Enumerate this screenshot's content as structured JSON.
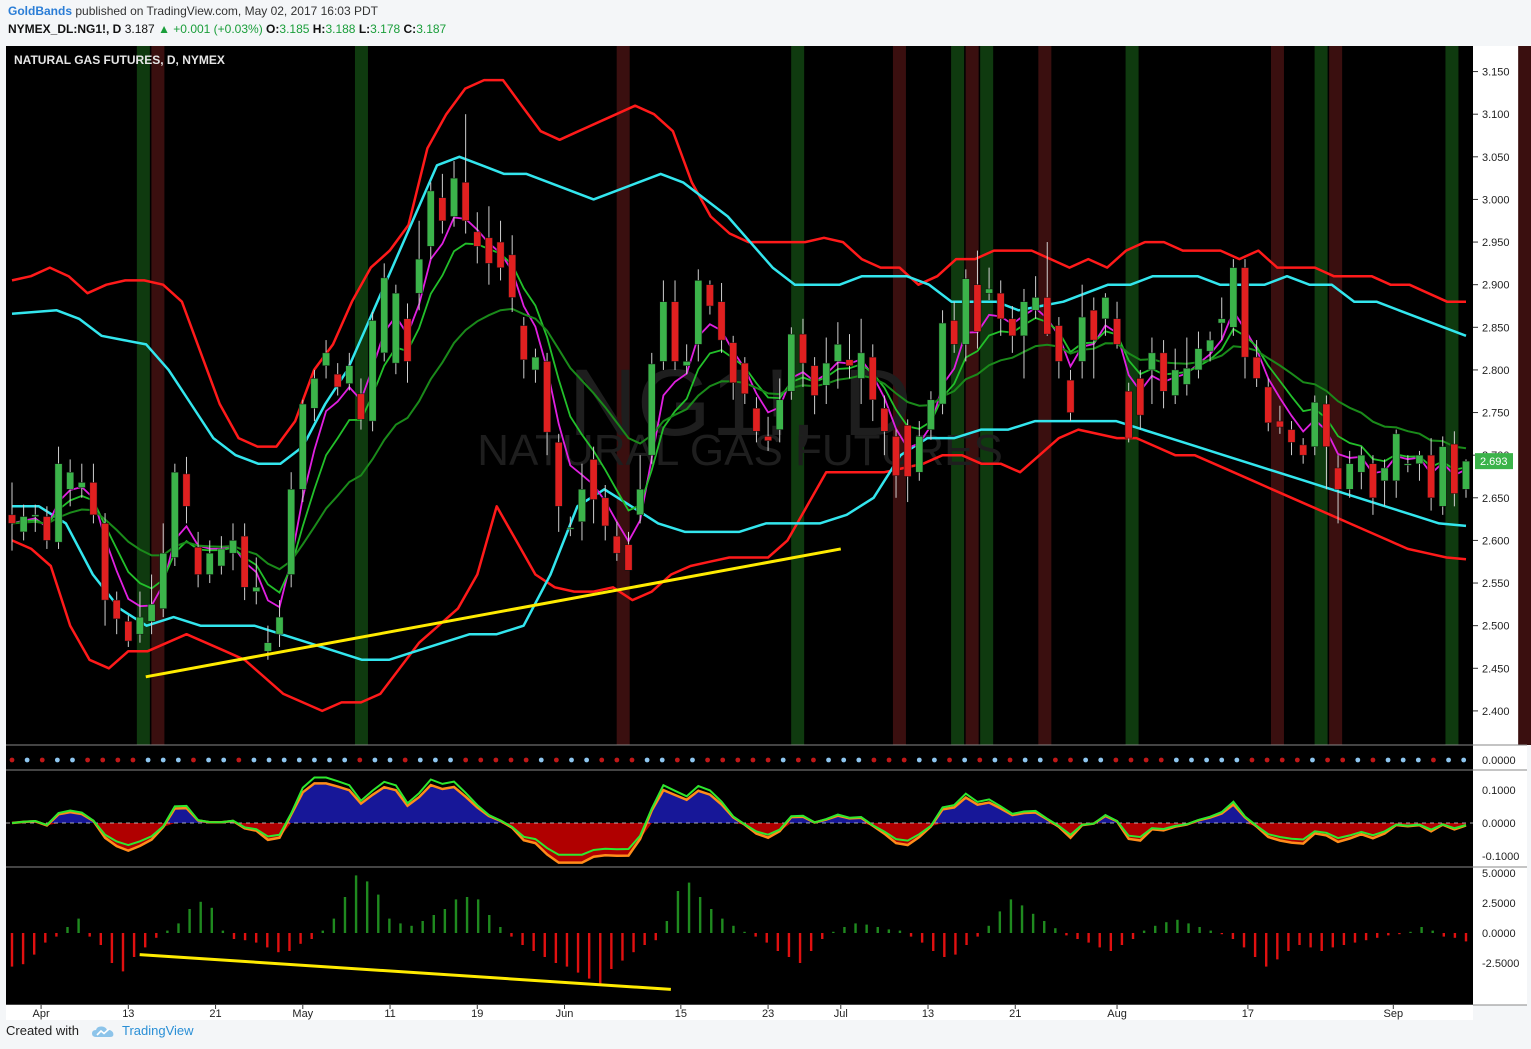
{
  "header": {
    "author": "GoldBands",
    "published": "published on TradingView.com, May 02, 2017 16:03 PDT",
    "symbol": "NYMEX_DL:NG1!, D",
    "last": "3.187",
    "change": "+0.001 (+0.03%)",
    "o_label": "O:",
    "o": "3.185",
    "h_label": "H:",
    "h": "3.188",
    "l_label": "L:",
    "l": "3.178",
    "c_label": "C:",
    "c": "3.187"
  },
  "footer": {
    "created_with": "Created with",
    "brand": "TradingView"
  },
  "colors": {
    "bull": "#3bb34a",
    "bear": "#e02020",
    "outer_band": "#ff1a1a",
    "inner_band": "#33e6ee",
    "ema_magenta": "#e020e0",
    "ema_green": "#22c02a",
    "trend": "#ffeb00"
  },
  "chart_data": {
    "type": "candlestick",
    "title": "NATURAL GAS FUTURES, D, NYMEX",
    "watermark": {
      "big": "NG1!, D",
      "sub": "NATURAL GAS FUTURES"
    },
    "last_price_label": "2.693",
    "ylim": [
      2.36,
      3.18
    ],
    "y_ticks": [
      "3.150",
      "3.100",
      "3.050",
      "3.000",
      "2.950",
      "2.900",
      "2.850",
      "2.800",
      "2.750",
      "2.700",
      "2.650",
      "2.600",
      "2.550",
      "2.500",
      "2.450",
      "2.400"
    ],
    "x_ticks": [
      {
        "label": "Apr",
        "i": 2
      },
      {
        "label": "13",
        "i": 8
      },
      {
        "label": "21",
        "i": 14
      },
      {
        "label": "May",
        "i": 20
      },
      {
        "label": "11",
        "i": 26
      },
      {
        "label": "19",
        "i": 32
      },
      {
        "label": "Jun",
        "i": 38
      },
      {
        "label": "15",
        "i": 46
      },
      {
        "label": "23",
        "i": 52
      },
      {
        "label": "Jul",
        "i": 57
      },
      {
        "label": "13",
        "i": 63
      },
      {
        "label": "21",
        "i": 69
      },
      {
        "label": "Aug",
        "i": 76
      },
      {
        "label": "17",
        "i": 85
      },
      {
        "label": "Sep",
        "i": 95
      }
    ],
    "candles": [
      [
        2.63,
        2.62,
        2.668,
        2.588
      ],
      [
        2.61,
        2.628,
        2.642,
        2.6
      ],
      [
        2.628,
        2.63,
        2.642,
        2.61
      ],
      [
        2.628,
        2.6,
        2.64,
        2.59
      ],
      [
        2.598,
        2.69,
        2.71,
        2.59
      ],
      [
        2.66,
        2.68,
        2.695,
        2.64
      ],
      [
        2.662,
        2.668,
        2.69,
        2.65
      ],
      [
        2.668,
        2.63,
        2.69,
        2.62
      ],
      [
        2.62,
        2.53,
        2.632,
        2.5
      ],
      [
        2.53,
        2.508,
        2.54,
        2.49
      ],
      [
        2.505,
        2.482,
        2.512,
        2.475
      ],
      [
        2.49,
        2.51,
        2.54,
        2.48
      ],
      [
        2.505,
        2.525,
        2.56,
        2.49
      ],
      [
        2.52,
        2.585,
        2.62,
        2.51
      ],
      [
        2.58,
        2.68,
        2.69,
        2.57
      ],
      [
        2.678,
        2.64,
        2.698,
        2.62
      ],
      [
        2.592,
        2.56,
        2.61,
        2.545
      ],
      [
        2.56,
        2.585,
        2.6,
        2.55
      ],
      [
        2.57,
        2.59,
        2.605,
        2.56
      ],
      [
        2.585,
        2.6,
        2.62,
        2.565
      ],
      [
        2.605,
        2.545,
        2.62,
        2.53
      ],
      [
        2.54,
        2.545,
        2.58,
        2.525
      ],
      [
        2.47,
        2.48,
        2.5,
        2.46
      ],
      [
        2.49,
        2.51,
        2.53,
        2.475
      ],
      [
        2.56,
        2.66,
        2.68,
        2.545
      ],
      [
        2.66,
        2.76,
        2.765,
        2.645
      ],
      [
        2.755,
        2.79,
        2.8,
        2.74
      ],
      [
        2.805,
        2.82,
        2.835,
        2.79
      ],
      [
        2.795,
        2.78,
        2.808,
        2.77
      ],
      [
        2.784,
        2.805,
        2.82,
        2.776
      ],
      [
        2.772,
        2.742,
        2.79,
        2.73
      ],
      [
        2.74,
        2.858,
        2.868,
        2.728
      ],
      [
        2.82,
        2.908,
        2.925,
        2.81
      ],
      [
        2.808,
        2.89,
        2.9,
        2.795
      ],
      [
        2.86,
        2.81,
        2.878,
        2.785
      ],
      [
        2.89,
        2.93,
        2.975,
        2.87
      ],
      [
        2.945,
        3.01,
        3.02,
        2.93
      ],
      [
        3.002,
        2.975,
        3.03,
        2.96
      ],
      [
        2.98,
        3.025,
        3.045,
        2.968
      ],
      [
        3.02,
        2.975,
        3.1,
        2.96
      ],
      [
        2.962,
        2.945,
        2.985,
        2.925
      ],
      [
        2.955,
        2.925,
        2.992,
        2.9
      ],
      [
        2.95,
        2.92,
        2.975,
        2.905
      ],
      [
        2.935,
        2.885,
        2.958,
        2.868
      ],
      [
        2.852,
        2.812,
        2.862,
        2.79
      ],
      [
        2.8,
        2.815,
        2.825,
        2.785
      ],
      [
        2.81,
        2.727,
        2.82,
        2.7
      ],
      [
        2.715,
        2.64,
        2.725,
        2.61
      ],
      [
        2.615,
        2.615,
        2.628,
        2.605
      ],
      [
        2.622,
        2.66,
        2.69,
        2.6
      ],
      [
        2.695,
        2.648,
        2.71,
        2.62
      ],
      [
        2.65,
        2.617,
        2.665,
        2.6
      ],
      [
        2.605,
        2.585,
        2.622,
        2.576
      ],
      [
        2.595,
        2.565,
        2.61,
        2.59
      ],
      [
        2.63,
        2.66,
        2.7,
        2.62
      ],
      [
        2.7,
        2.807,
        2.82,
        2.69
      ],
      [
        2.81,
        2.88,
        2.905,
        2.8
      ],
      [
        2.88,
        2.81,
        2.905,
        2.8
      ],
      [
        2.805,
        2.81,
        2.83,
        2.795
      ],
      [
        2.83,
        2.905,
        2.918,
        2.81
      ],
      [
        2.9,
        2.875,
        2.905,
        2.865
      ],
      [
        2.88,
        2.835,
        2.902,
        2.82
      ],
      [
        2.832,
        2.785,
        2.84,
        2.765
      ],
      [
        2.808,
        2.772,
        2.815,
        2.76
      ],
      [
        2.755,
        2.728,
        2.768,
        2.715
      ],
      [
        2.722,
        2.717,
        2.745,
        2.705
      ],
      [
        2.73,
        2.765,
        2.79,
        2.715
      ],
      [
        2.775,
        2.842,
        2.85,
        2.765
      ],
      [
        2.842,
        2.808,
        2.86,
        2.78
      ],
      [
        2.805,
        2.77,
        2.815,
        2.748
      ],
      [
        2.782,
        2.808,
        2.838,
        2.76
      ],
      [
        2.81,
        2.83,
        2.856,
        2.778
      ],
      [
        2.812,
        2.805,
        2.842,
        2.79
      ],
      [
        2.79,
        2.82,
        2.86,
        2.76
      ],
      [
        2.815,
        2.765,
        2.83,
        2.74
      ],
      [
        2.755,
        2.728,
        2.77,
        2.7
      ],
      [
        2.722,
        2.676,
        2.73,
        2.65
      ],
      [
        2.735,
        2.675,
        2.742,
        2.645
      ],
      [
        2.68,
        2.722,
        2.74,
        2.67
      ],
      [
        2.73,
        2.765,
        2.775,
        2.718
      ],
      [
        2.76,
        2.855,
        2.87,
        2.748
      ],
      [
        2.858,
        2.83,
        2.88,
        2.82
      ],
      [
        2.83,
        2.907,
        2.918,
        2.81
      ],
      [
        2.9,
        2.845,
        2.94,
        2.825
      ],
      [
        2.89,
        2.895,
        2.92,
        2.882
      ],
      [
        2.89,
        2.86,
        2.905,
        2.84
      ],
      [
        2.86,
        2.84,
        2.875,
        2.82
      ],
      [
        2.84,
        2.88,
        2.895,
        2.79
      ],
      [
        2.87,
        2.885,
        2.91,
        2.86
      ],
      [
        2.885,
        2.842,
        2.95,
        2.84
      ],
      [
        2.852,
        2.81,
        2.862,
        2.79
      ],
      [
        2.788,
        2.75,
        2.8,
        2.74
      ],
      [
        2.81,
        2.862,
        2.9,
        2.79
      ],
      [
        2.87,
        2.835,
        2.885,
        2.79
      ],
      [
        2.86,
        2.885,
        2.89,
        2.84
      ],
      [
        2.86,
        2.83,
        2.88,
        2.825
      ],
      [
        2.775,
        2.72,
        2.785,
        2.715
      ],
      [
        2.79,
        2.747,
        2.8,
        2.73
      ],
      [
        2.8,
        2.82,
        2.838,
        2.76
      ],
      [
        2.82,
        2.775,
        2.835,
        2.755
      ],
      [
        2.77,
        2.8,
        2.825,
        2.76
      ],
      [
        2.783,
        2.802,
        2.838,
        2.77
      ],
      [
        2.8,
        2.825,
        2.845,
        2.79
      ],
      [
        2.822,
        2.835,
        2.845,
        2.81
      ],
      [
        2.855,
        2.86,
        2.885,
        2.835
      ],
      [
        2.85,
        2.92,
        2.93,
        2.84
      ],
      [
        2.92,
        2.815,
        2.93,
        2.79
      ],
      [
        2.815,
        2.79,
        2.835,
        2.78
      ],
      [
        2.78,
        2.738,
        2.79,
        2.728
      ],
      [
        2.74,
        2.733,
        2.758,
        2.725
      ],
      [
        2.73,
        2.715,
        2.74,
        2.7
      ],
      [
        2.712,
        2.7,
        2.72,
        2.69
      ],
      [
        2.71,
        2.762,
        2.77,
        2.7
      ],
      [
        2.76,
        2.71,
        2.77,
        2.66
      ],
      [
        2.685,
        2.66,
        2.7,
        2.62
      ],
      [
        2.66,
        2.69,
        2.705,
        2.65
      ],
      [
        2.68,
        2.7,
        2.71,
        2.66
      ],
      [
        2.69,
        2.65,
        2.7,
        2.63
      ],
      [
        2.67,
        2.685,
        2.695,
        2.64
      ],
      [
        2.67,
        2.725,
        2.73,
        2.65
      ],
      [
        2.69,
        2.69,
        2.7,
        2.68
      ],
      [
        2.69,
        2.7,
        2.705,
        2.67
      ],
      [
        2.7,
        2.65,
        2.72,
        2.635
      ],
      [
        2.64,
        2.71,
        2.722,
        2.63
      ],
      [
        2.713,
        2.655,
        2.728,
        2.64
      ],
      [
        2.66,
        2.693,
        2.695,
        2.65
      ]
    ],
    "outer_upper": [
      2.905,
      2.91,
      2.92,
      2.91,
      2.89,
      2.9,
      2.905,
      2.905,
      2.9,
      2.88,
      2.82,
      2.76,
      2.72,
      2.71,
      2.71,
      2.74,
      2.8,
      2.83,
      2.88,
      2.92,
      2.94,
      2.97,
      3.06,
      3.1,
      3.13,
      3.14,
      3.14,
      3.11,
      3.08,
      3.07,
      3.08,
      3.09,
      3.1,
      3.11,
      3.1,
      3.08,
      3.02,
      2.98,
      2.96,
      2.95,
      2.95,
      2.95,
      2.95,
      2.955,
      2.95,
      2.93,
      2.92,
      2.92,
      2.9,
      2.91,
      2.93,
      2.93,
      2.94,
      2.94,
      2.94,
      2.93,
      2.92,
      2.93,
      2.92,
      2.94,
      2.95,
      2.95,
      2.94,
      2.94,
      2.94,
      2.93,
      2.94,
      2.92,
      2.92,
      2.92,
      2.91,
      2.91,
      2.91,
      2.9,
      2.9,
      2.89,
      2.88,
      2.88
    ],
    "outer_lower": [
      2.6,
      2.59,
      2.57,
      2.5,
      2.46,
      2.45,
      2.47,
      2.47,
      2.48,
      2.49,
      2.48,
      2.47,
      2.46,
      2.44,
      2.42,
      2.41,
      2.4,
      2.41,
      2.41,
      2.42,
      2.45,
      2.48,
      2.5,
      2.52,
      2.56,
      2.64,
      2.6,
      2.56,
      2.545,
      2.54,
      2.54,
      2.545,
      2.53,
      2.54,
      2.56,
      2.57,
      2.575,
      2.58,
      2.58,
      2.58,
      2.6,
      2.64,
      2.68,
      2.68,
      2.68,
      2.68,
      2.685,
      2.69,
      2.7,
      2.7,
      2.69,
      2.69,
      2.68,
      2.7,
      2.72,
      2.73,
      2.725,
      2.72,
      2.72,
      2.71,
      2.7,
      2.7,
      2.69,
      2.68,
      2.67,
      2.66,
      2.65,
      2.64,
      2.63,
      2.62,
      2.61,
      2.6,
      2.59,
      2.585,
      2.58,
      2.578
    ],
    "inner_upper": [
      2.866,
      2.868,
      2.87,
      2.86,
      2.84,
      2.835,
      2.83,
      2.8,
      2.76,
      2.72,
      2.7,
      2.69,
      2.69,
      2.71,
      2.76,
      2.8,
      2.86,
      2.92,
      2.98,
      3.04,
      3.05,
      3.04,
      3.03,
      3.03,
      3.02,
      3.01,
      3.0,
      3.01,
      3.02,
      3.03,
      3.02,
      3.0,
      2.98,
      2.95,
      2.92,
      2.9,
      2.9,
      2.9,
      2.91,
      2.91,
      2.91,
      2.9,
      2.88,
      2.88,
      2.88,
      2.87,
      2.875,
      2.88,
      2.89,
      2.9,
      2.9,
      2.91,
      2.91,
      2.91,
      2.9,
      2.9,
      2.9,
      2.91,
      2.9,
      2.9,
      2.88,
      2.88,
      2.87,
      2.86,
      2.85,
      2.84
    ],
    "inner_lower": [
      2.64,
      2.64,
      2.62,
      2.56,
      2.52,
      2.5,
      2.51,
      2.5,
      2.5,
      2.5,
      2.49,
      2.48,
      2.47,
      2.46,
      2.46,
      2.47,
      2.48,
      2.49,
      2.49,
      2.5,
      2.56,
      2.64,
      2.66,
      2.64,
      2.62,
      2.61,
      2.61,
      2.61,
      2.62,
      2.62,
      2.62,
      2.63,
      2.65,
      2.7,
      2.72,
      2.72,
      2.73,
      2.73,
      2.74,
      2.74,
      2.74,
      2.74,
      2.73,
      2.72,
      2.71,
      2.7,
      2.69,
      2.68,
      2.67,
      2.66,
      2.65,
      2.64,
      2.63,
      2.62,
      2.617
    ]
  },
  "signal_dots": {
    "zero_label": "0.0000"
  },
  "oscillator": {
    "ticks": [
      "0.1000",
      "0.0000",
      "-0.1000"
    ]
  },
  "histogram": {
    "ticks": [
      "5.0000",
      "2.5000",
      "0.0000",
      "-2.5000"
    ],
    "values": [
      -2.8,
      -2.6,
      -1.8,
      -0.8,
      -0.3,
      0.5,
      1.2,
      -0.3,
      -1.0,
      -2.5,
      -3.2,
      -2.0,
      -1.2,
      -0.4,
      0.2,
      0.8,
      2.0,
      2.6,
      2.1,
      0.2,
      -0.5,
      -0.6,
      -0.8,
      -1.2,
      -1.6,
      -1.5,
      -0.9,
      -0.5,
      0.2,
      1.2,
      3.0,
      4.8,
      4.3,
      3.2,
      1.2,
      0.8,
      0.6,
      1.0,
      1.5,
      2.0,
      2.8,
      3.0,
      2.8,
      1.5,
      0.5,
      -0.3,
      -1.0,
      -1.5,
      -2.0,
      -2.5,
      -2.8,
      -3.3,
      -3.8,
      -4.3,
      -3.0,
      -2.3,
      -1.6,
      -1.0,
      -0.6,
      1.0,
      3.5,
      4.2,
      3.0,
      2.0,
      1.2,
      0.6,
      0.1,
      -0.3,
      -0.8,
      -1.5,
      -2.0,
      -2.5,
      -1.5,
      -0.5,
      0.1,
      0.5,
      0.8,
      0.7,
      0.5,
      0.3,
      0.2,
      -0.3,
      -0.8,
      -1.5,
      -2.0,
      -1.8,
      -1.0,
      -0.3,
      0.6,
      1.8,
      2.8,
      2.3,
      1.6,
      1.0,
      0.4,
      -0.2,
      -0.5,
      -0.8,
      -1.2,
      -1.5,
      -1.0,
      -0.5,
      0.2,
      0.6,
      0.9,
      1.1,
      0.8,
      0.5,
      0.2,
      -0.1,
      -0.5,
      -1.2,
      -2.0,
      -2.8,
      -2.2,
      -1.5,
      -1.0,
      -1.2,
      -1.5,
      -1.2,
      -1.0,
      -0.8,
      -0.6,
      -0.4,
      -0.2,
      -0.1,
      0.1,
      0.5,
      0.2,
      -0.3,
      -0.4,
      -0.7
    ]
  },
  "trendlines": {
    "price": [
      [
        23,
        2.44
      ],
      [
        57,
        2.59
      ]
    ],
    "histogram": [
      [
        23,
        -1.8
      ],
      [
        53,
        -4.7
      ]
    ]
  }
}
